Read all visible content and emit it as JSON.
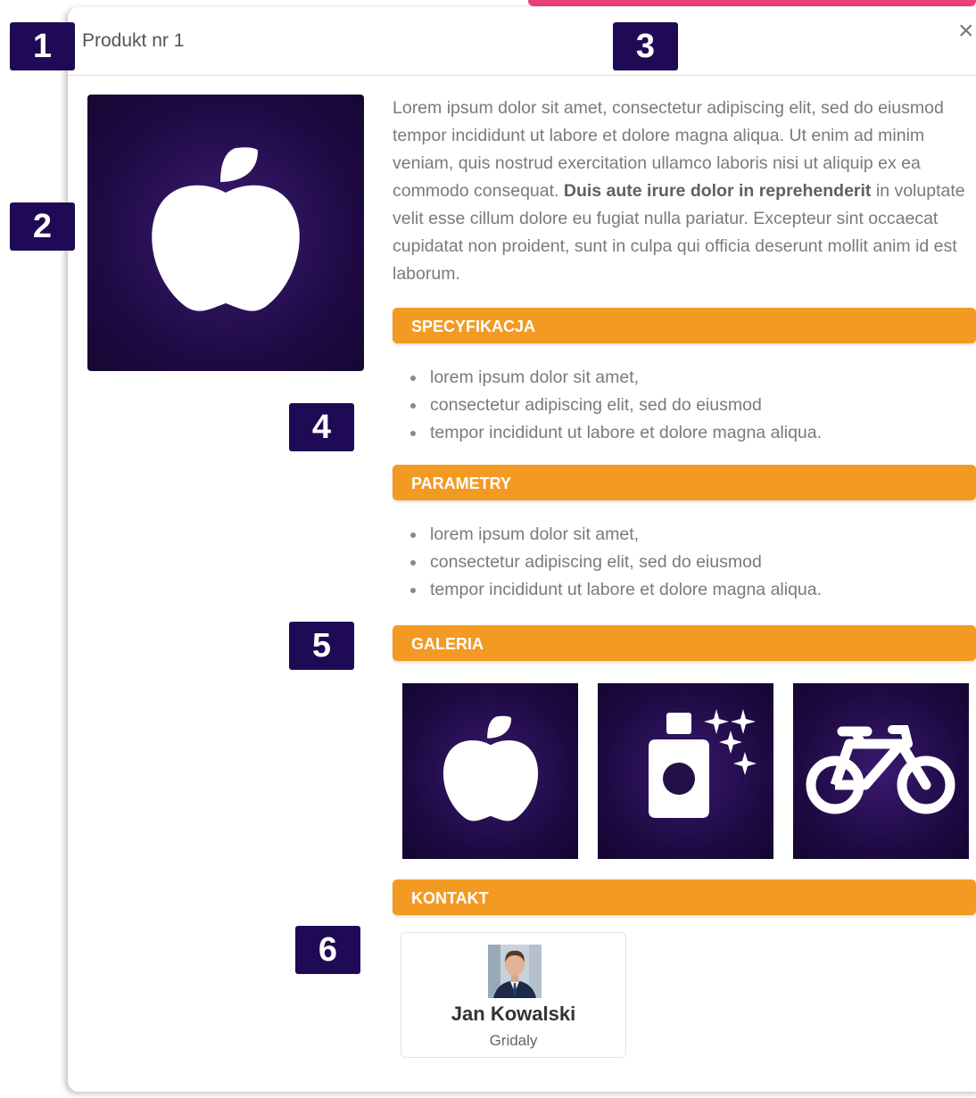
{
  "modal": {
    "title": "Produkt nr 1",
    "close_symbol": "×"
  },
  "badges": [
    "1",
    "2",
    "3",
    "4",
    "5",
    "6"
  ],
  "description": {
    "part1": "Lorem ipsum dolor sit amet, consectetur adipiscing elit, sed do eiusmod tempor incididunt ut labore et dolore magna aliqua. Ut enim ad minim veniam, quis nostrud exercitation ullamco laboris nisi ut aliquip ex ea commodo consequat. ",
    "bold": "Duis aute irure dolor in reprehenderit",
    "part2": " in voluptate velit esse cillum dolore eu fugiat nulla pariatur. Excepteur sint occaecat cupidatat non proident, sunt in culpa qui officia deserunt mollit anim id est laborum."
  },
  "sections": {
    "specification": {
      "title": "SPECYFIKACJA",
      "items": [
        "lorem ipsum dolor sit amet,",
        "consectetur adipiscing elit, sed do eiusmod",
        "tempor incididunt ut labore et dolore magna aliqua."
      ]
    },
    "parameters": {
      "title": "PARAMETRY",
      "items": [
        "lorem ipsum dolor sit amet,",
        "consectetur adipiscing elit, sed do eiusmod",
        "tempor incididunt ut labore et dolore magna aliqua."
      ]
    },
    "gallery": {
      "title": "GALERIA",
      "images": [
        "apple-icon",
        "perfume-icon",
        "bicycle-icon"
      ]
    },
    "contact": {
      "title": "KONTAKT",
      "name": "Jan Kowalski",
      "company": "Gridaly"
    }
  },
  "colors": {
    "section_header": "#f39a22",
    "badge": "#1f0b55",
    "image_background": "#1e0a44",
    "top_accent": "#ea3f7c"
  }
}
